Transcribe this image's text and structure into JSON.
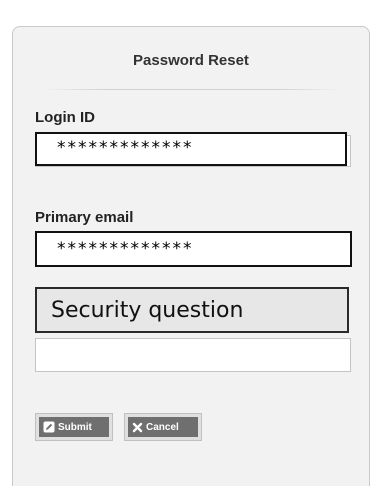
{
  "form": {
    "title": "Password Reset",
    "login_id": {
      "label": "Login ID",
      "value": "*************"
    },
    "primary_email": {
      "label": "Primary email",
      "value": "*************"
    },
    "security_question": {
      "label": "Security question",
      "answer": ""
    }
  },
  "buttons": {
    "submit_label": "Submit",
    "cancel_label": "Cancel"
  },
  "icons": {
    "submit": "edit-icon",
    "cancel": "close-icon"
  },
  "colors": {
    "panel_background": "#f2f2f2",
    "button_background": "#6f6f6f",
    "security_box_background": "#e7e7e7"
  }
}
